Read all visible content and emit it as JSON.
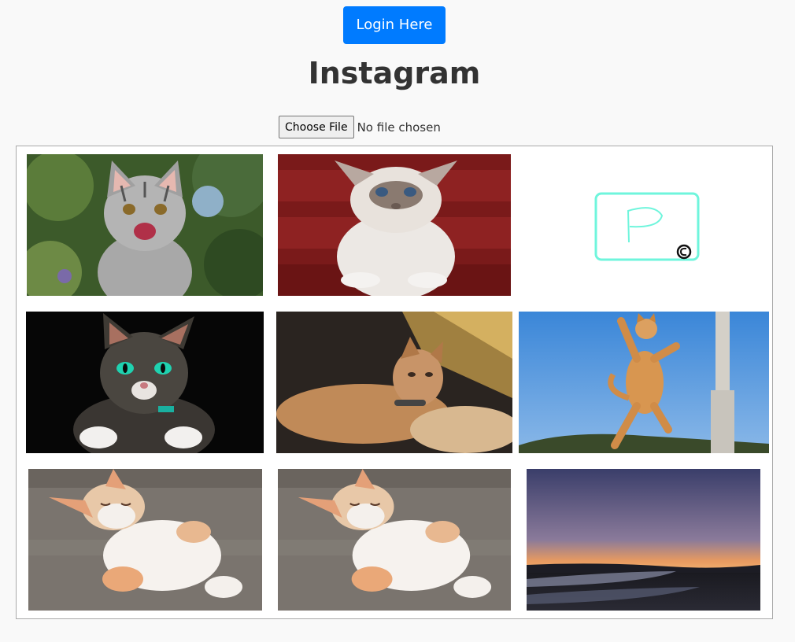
{
  "header": {
    "login_label": "Login Here",
    "title": "Instagram"
  },
  "upload": {
    "button_label": "Choose File",
    "status_text": "No file chosen"
  },
  "gallery": {
    "photos": [
      {
        "icon": "laughing-tabby-kitten-image"
      },
      {
        "icon": "grumpy-white-cat-image"
      },
      {
        "icon": "hand-drawn-logo-image"
      },
      {
        "icon": "green-eyed-tabby-cat-image"
      },
      {
        "icon": "cats-movie-character-image"
      },
      {
        "icon": "jumping-orange-cat-image"
      },
      {
        "icon": "sleeping-kitten-image"
      },
      {
        "icon": "sleeping-kitten-image"
      },
      {
        "icon": "sunset-beach-image"
      }
    ],
    "colors": {
      "accent": "#007bff",
      "logo_frame": "#6ff5dc"
    }
  }
}
